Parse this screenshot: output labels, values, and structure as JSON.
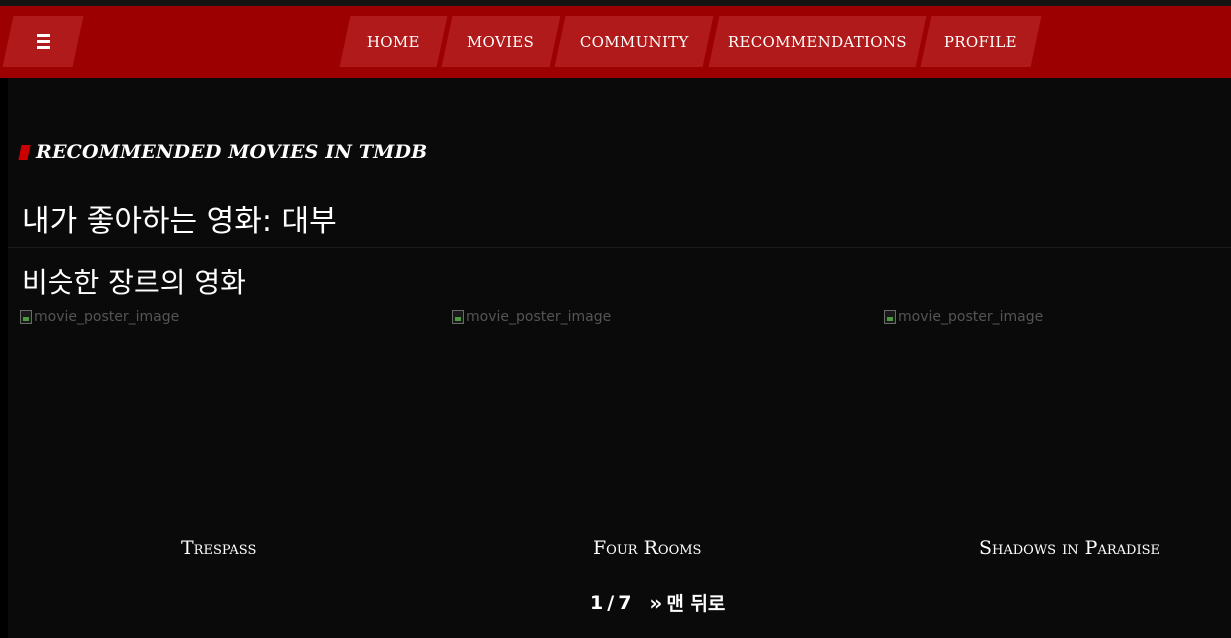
{
  "nav": {
    "menu_icon": "hamburger-menu-icon",
    "items": [
      {
        "label": "HOME"
      },
      {
        "label": "MOVIES"
      },
      {
        "label": "COMMUNITY"
      },
      {
        "label": "RECOMMENDATIONS"
      },
      {
        "label": "PROFILE"
      }
    ]
  },
  "section": {
    "title": "RECOMMENDED MOVIES IN TMDB"
  },
  "favorite": {
    "heading": "내가 좋아하는 영화: 대부"
  },
  "similar": {
    "heading": "비슷한 장르의 영화",
    "movies": [
      {
        "poster_alt": "movie_poster_image",
        "title": "Trespass"
      },
      {
        "poster_alt": "movie_poster_image",
        "title": "Four Rooms"
      },
      {
        "poster_alt": "movie_poster_image",
        "title": "Shadows in Paradise"
      }
    ]
  },
  "pagination": {
    "current": "1",
    "separator": "/",
    "total": "7",
    "next_icon": "double-chevron-right-icon",
    "last_label": "맨 뒤로"
  },
  "colors": {
    "navbar": "#9c0000",
    "nav_block": "#b01a1a",
    "accent": "#cc0000",
    "background": "#0a0a0a"
  }
}
